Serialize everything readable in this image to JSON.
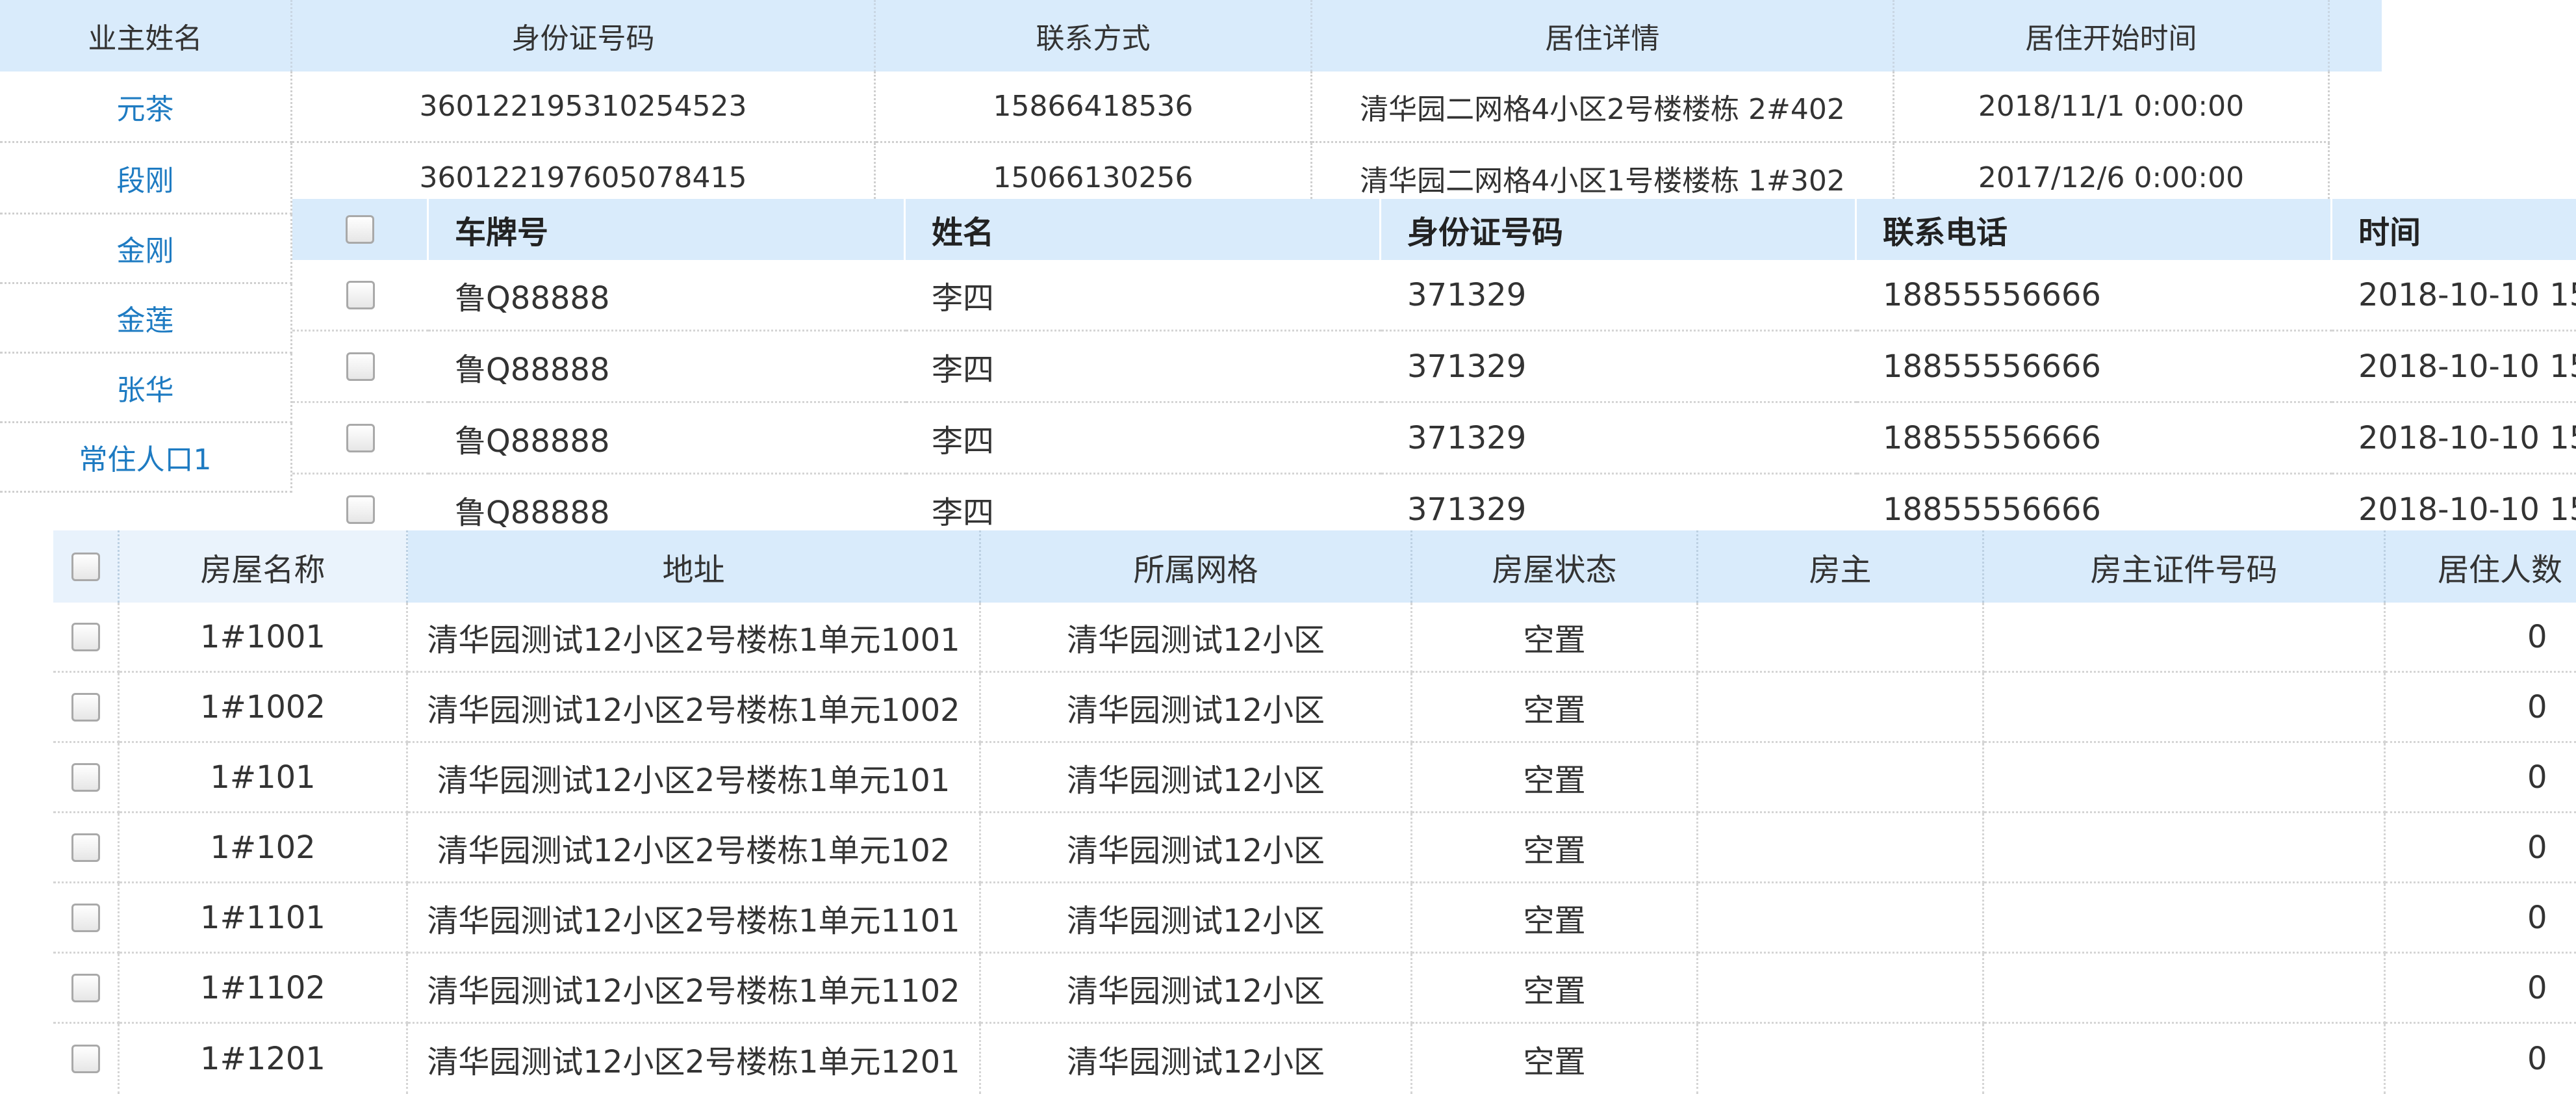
{
  "owner_table": {
    "headers": [
      "业主姓名",
      "身份证号码",
      "联系方式",
      "居住详情",
      "居住开始时间"
    ],
    "rows": [
      {
        "name": "元茶",
        "id": "360122195310254523",
        "phone": "15866418536",
        "detail": "清华园二网格4小区2号楼楼栋 2#402",
        "start": "2018/11/1 0:00:00"
      },
      {
        "name": "段刚",
        "id": "360122197605078415",
        "phone": "15066130256",
        "detail": "清华园二网格4小区1号楼楼栋 1#302",
        "start": "2017/12/6 0:00:00"
      },
      {
        "name": "金刚"
      },
      {
        "name": "金莲"
      },
      {
        "name": "张华"
      },
      {
        "name": "常住人口1"
      }
    ]
  },
  "vehicle_table": {
    "headers": [
      "车牌号",
      "姓名",
      "身份证号码",
      "联系电话",
      "时间"
    ],
    "rows": [
      {
        "plate": "鲁Q88888",
        "name": "李四",
        "id": "371329",
        "phone": "18855556666",
        "time": "2018-10-10 15"
      },
      {
        "plate": "鲁Q88888",
        "name": "李四",
        "id": "371329",
        "phone": "18855556666",
        "time": "2018-10-10 15"
      },
      {
        "plate": "鲁Q88888",
        "name": "李四",
        "id": "371329",
        "phone": "18855556666",
        "time": "2018-10-10 15"
      },
      {
        "plate": "鲁Q88888",
        "name": "李四",
        "id": "371329",
        "phone": "18855556666",
        "time": "2018-10-10 15"
      }
    ]
  },
  "house_table": {
    "headers": [
      "房屋名称",
      "地址",
      "所属网格",
      "房屋状态",
      "房主",
      "房主证件号码",
      "居住人数"
    ],
    "rows": [
      {
        "name": "1#1001",
        "address": "清华园测试12小区2号楼栋1单元1001",
        "grid": "清华园测试12小区",
        "status": "空置",
        "owner": "",
        "owner_id": "",
        "residents": "0"
      },
      {
        "name": "1#1002",
        "address": "清华园测试12小区2号楼栋1单元1002",
        "grid": "清华园测试12小区",
        "status": "空置",
        "owner": "",
        "owner_id": "",
        "residents": "0"
      },
      {
        "name": "1#101",
        "address": "清华园测试12小区2号楼栋1单元101",
        "grid": "清华园测试12小区",
        "status": "空置",
        "owner": "",
        "owner_id": "",
        "residents": "0"
      },
      {
        "name": "1#102",
        "address": "清华园测试12小区2号楼栋1单元102",
        "grid": "清华园测试12小区",
        "status": "空置",
        "owner": "",
        "owner_id": "",
        "residents": "0"
      },
      {
        "name": "1#1101",
        "address": "清华园测试12小区2号楼栋1单元1101",
        "grid": "清华园测试12小区",
        "status": "空置",
        "owner": "",
        "owner_id": "",
        "residents": "0"
      },
      {
        "name": "1#1102",
        "address": "清华园测试12小区2号楼栋1单元1102",
        "grid": "清华园测试12小区",
        "status": "空置",
        "owner": "",
        "owner_id": "",
        "residents": "0"
      },
      {
        "name": "1#1201",
        "address": "清华园测试12小区2号楼栋1单元1201",
        "grid": "清华园测试12小区",
        "status": "空置",
        "owner": "",
        "owner_id": "",
        "residents": "0"
      }
    ]
  },
  "colors": {
    "header_bg": "#d9ebfb",
    "link": "#1e7bc2",
    "text": "#333333"
  }
}
